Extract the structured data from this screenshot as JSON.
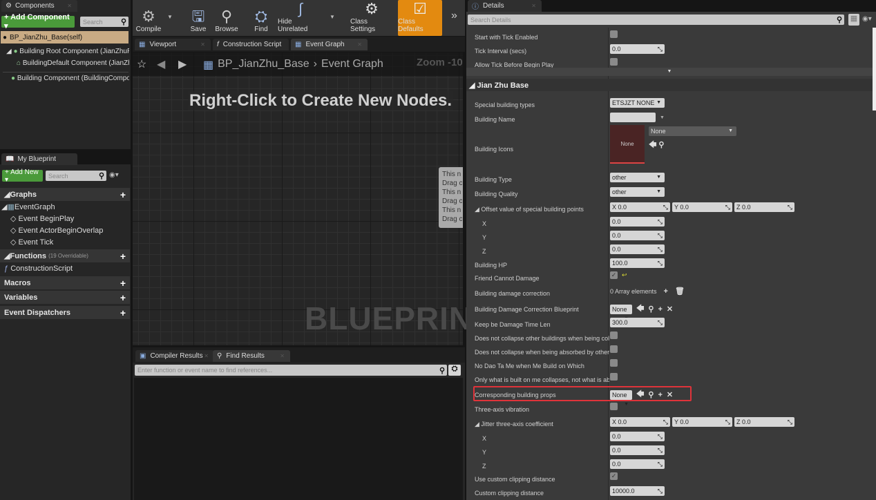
{
  "components": {
    "tab": "Components",
    "add_button": "+ Add Component ▾",
    "search_placeholder": "Search",
    "self": "BP_JianZhu_Base(self)",
    "items": [
      "Building Root Component (JianZhuRoot",
      "BuildingDefault Component (JianZhu",
      "Building Component (BuildingCompone"
    ]
  },
  "my_blueprint": {
    "tab": "My Blueprint",
    "add_button": "+ Add New ▾",
    "search_placeholder": "Search",
    "graphs": "Graphs",
    "event_graph": "EventGraph",
    "events": [
      "Event BeginPlay",
      "Event ActorBeginOverlap",
      "Event Tick"
    ],
    "functions": "Functions",
    "functions_count": "(19 Overridable)",
    "construction_script": "ConstructionScript",
    "macros": "Macros",
    "variables": "Variables",
    "event_dispatchers": "Event Dispatchers"
  },
  "toolbar": {
    "compile": "Compile",
    "save": "Save",
    "browse": "Browse",
    "find": "Find",
    "hide_unrelated": "Hide Unrelated",
    "class_settings": "Class Settings",
    "class_defaults": "Class Defaults",
    "accent": "#e38a10"
  },
  "editor_tabs": [
    "Viewport",
    "Construction Script",
    "Event Graph"
  ],
  "graph": {
    "breadcrumb_root": "BP_JianZhu_Base",
    "breadcrumb_leaf": "Event Graph",
    "zoom": "Zoom -10",
    "hint": "Right-Click to Create New Nodes.",
    "watermark": "BLUEPRINT",
    "comment_lines": [
      "This n",
      "Drag c",
      "This n",
      "Drag c",
      "This n",
      "Drag c"
    ]
  },
  "bottom": {
    "tabs": [
      "Compiler Results",
      "Find Results"
    ],
    "find_placeholder": "Enter function or event name to find references..."
  },
  "details": {
    "tab": "Details",
    "search_placeholder": "Search Details",
    "section": "Jian Zhu Base",
    "highlight_color": "#e0333a",
    "rows": [
      {
        "label": "Start with Tick Enabled",
        "type": "checkbox",
        "checked": false
      },
      {
        "label": "Tick Interval (secs)",
        "type": "number",
        "value": "0.0"
      },
      {
        "label": "Allow Tick Before Begin Play",
        "type": "checkbox",
        "checked": false
      },
      {
        "type": "divider"
      },
      {
        "type": "section"
      },
      {
        "label": "Special building types",
        "type": "dropdown",
        "value": "ETSJZT NONE"
      },
      {
        "label": "Building Name",
        "type": "text",
        "value": ""
      },
      {
        "label": "Building Icons",
        "type": "icon",
        "value": "None",
        "thumb": "None"
      },
      {
        "label": "Building Type",
        "type": "dropdown",
        "value": "other"
      },
      {
        "label": "Building Quality",
        "type": "dropdown",
        "value": "other"
      },
      {
        "label": "Offset value of special building points",
        "type": "vector",
        "expand": true,
        "x": "0.0",
        "y": "0.0",
        "z": "0.0"
      },
      {
        "label": "X",
        "type": "number",
        "value": "0.0",
        "indent": true
      },
      {
        "label": "Y",
        "type": "number",
        "value": "0.0",
        "indent": true
      },
      {
        "label": "Z",
        "type": "number",
        "value": "0.0",
        "indent": true
      },
      {
        "label": "Building HP",
        "type": "number",
        "value": "100.0"
      },
      {
        "label": "Friend Cannot Damage",
        "type": "checkbox",
        "checked": true,
        "reset": true
      },
      {
        "label": "Building damage correction",
        "type": "array",
        "value": "0 Array elements"
      },
      {
        "label": "Building Damage Correction Blueprint",
        "type": "asset",
        "value": "None"
      },
      {
        "label": "Keep be Damage Time Len",
        "type": "number",
        "value": "300.0"
      },
      {
        "label": "Does not collapse other buildings when being collapsed",
        "type": "checkbox",
        "checked": false
      },
      {
        "label": "Does not collapse when being absorbed by other buildings",
        "type": "checkbox",
        "checked": false
      },
      {
        "label": "No Dao Ta Me when Me Build on Which",
        "type": "checkbox",
        "checked": false
      },
      {
        "label": "Only what is built on me collapses, not what is absorbed",
        "type": "checkbox",
        "checked": false
      },
      {
        "label": "Corresponding building props",
        "type": "asset",
        "value": "None",
        "highlight": true
      },
      {
        "label": "Three-axis vibration",
        "type": "checkbox",
        "checked": false
      },
      {
        "label": "Jitter three-axis coefficient",
        "type": "vector",
        "expand": true,
        "x": "0.0",
        "y": "0.0",
        "z": "0.0"
      },
      {
        "label": "X",
        "type": "number",
        "value": "0.0",
        "indent": true
      },
      {
        "label": "Y",
        "type": "number",
        "value": "0.0",
        "indent": true
      },
      {
        "label": "Z",
        "type": "number",
        "value": "0.0",
        "indent": true
      },
      {
        "label": "Use custom clipping distance",
        "type": "checkbox",
        "checked": true
      },
      {
        "label": "Custom clipping distance",
        "type": "number",
        "value": "10000.0"
      }
    ]
  }
}
